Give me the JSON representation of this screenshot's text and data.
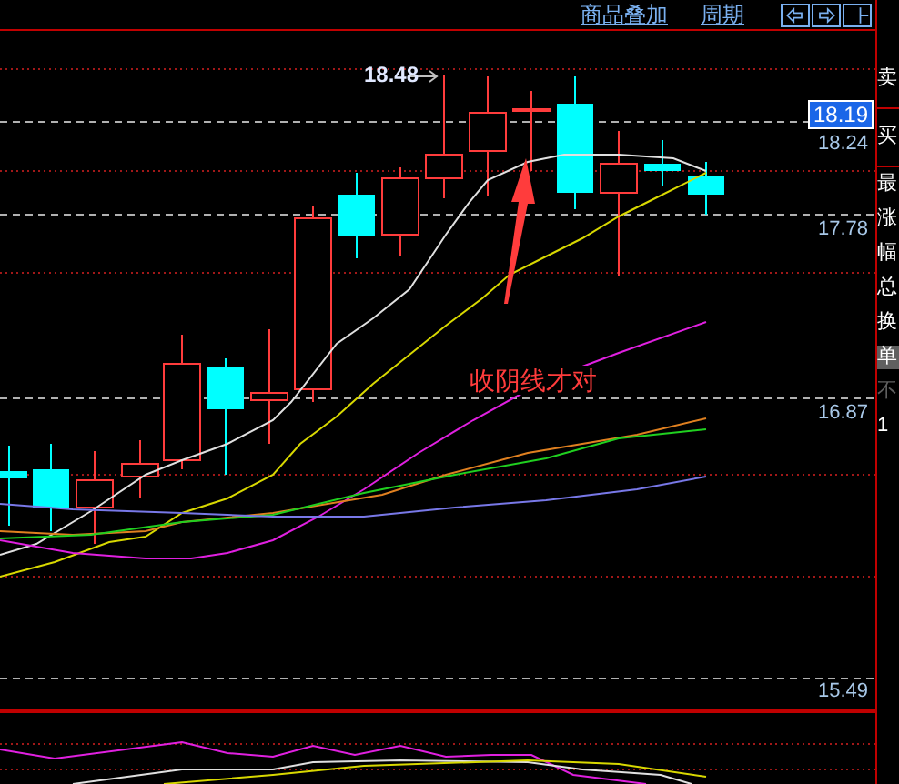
{
  "toolbar": {
    "links": [
      "商品叠加",
      "周期"
    ],
    "icon_buttons": [
      {
        "kind": "left"
      },
      {
        "kind": "right"
      },
      {
        "kind": "layout"
      }
    ]
  },
  "chart": {
    "high_label": "18.48",
    "current_price": "18.19",
    "annotation": "收阴线才对",
    "price_labels": [
      "18.24",
      "17.78",
      "16.87",
      "15.49"
    ]
  },
  "sidebar": {
    "items": [
      {
        "text": "卖",
        "kind": "header",
        "selected": false,
        "muted": false
      },
      {
        "text": "买",
        "kind": "header",
        "selected": false,
        "muted": false
      },
      {
        "text": "最",
        "kind": "row",
        "selected": false,
        "muted": false
      },
      {
        "text": "涨",
        "kind": "row",
        "selected": false,
        "muted": false
      },
      {
        "text": "幅",
        "kind": "row",
        "selected": false,
        "muted": false
      },
      {
        "text": "总",
        "kind": "row",
        "selected": false,
        "muted": false
      },
      {
        "text": "换",
        "kind": "row",
        "selected": false,
        "muted": false
      },
      {
        "text": "单",
        "kind": "row",
        "selected": true,
        "muted": false
      },
      {
        "text": "不",
        "kind": "row",
        "selected": false,
        "muted": true
      },
      {
        "text": "1",
        "kind": "row",
        "selected": false,
        "muted": false
      }
    ]
  }
}
